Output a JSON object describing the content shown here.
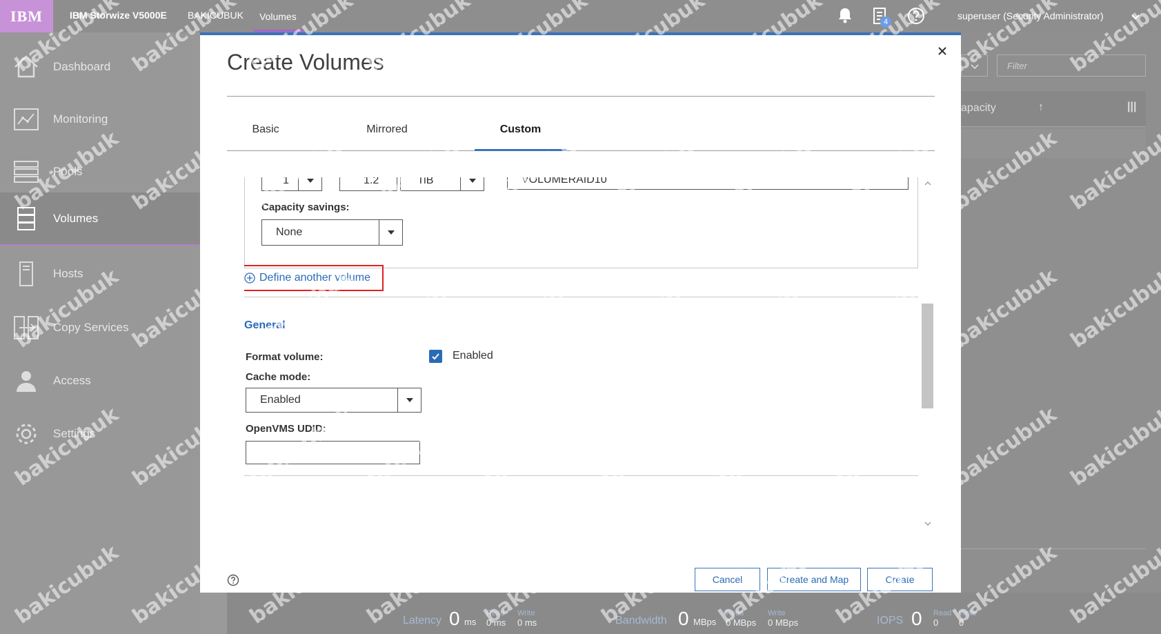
{
  "topbar": {
    "logo": "IBM",
    "product": "IBM Storwize V5000E",
    "system": "BAKICUBUK",
    "page": "Volumes",
    "tasks_count": "4",
    "user": "superuser (Security Administrator)"
  },
  "sidebar": {
    "items": [
      {
        "label": "Dashboard",
        "icon": "home-icon"
      },
      {
        "label": "Monitoring",
        "icon": "monitoring-icon"
      },
      {
        "label": "Pools",
        "icon": "pools-icon"
      },
      {
        "label": "Volumes",
        "icon": "volumes-icon",
        "active": true
      },
      {
        "label": "Hosts",
        "icon": "hosts-icon"
      },
      {
        "label": "Copy Services",
        "icon": "copy-services-icon"
      },
      {
        "label": "Access",
        "icon": "access-icon"
      },
      {
        "label": "Settings",
        "icon": "settings-icon"
      }
    ]
  },
  "background": {
    "filter_placeholder": "Filter",
    "capacity_col": "apacity"
  },
  "modal": {
    "title": "Create Volumes",
    "tabs": [
      "Basic",
      "Mirrored",
      "Custom"
    ],
    "active_tab": "Custom",
    "volume": {
      "quantity": "1",
      "capacity": "1.2",
      "unit": "TiB",
      "name": "VOLUMERAID10"
    },
    "capacity_savings_label": "Capacity savings:",
    "capacity_savings_value": "None",
    "define_link": "Define another volume",
    "general_header": "General",
    "format_volume_label": "Format volume:",
    "format_volume_checked": true,
    "format_volume_text": "Enabled",
    "cache_mode_label": "Cache mode:",
    "cache_mode_value": "Enabled",
    "openvms_label": "OpenVMS UDID:",
    "openvms_value": "",
    "buttons": {
      "cancel": "Cancel",
      "create_map": "Create and Map",
      "create": "Create"
    }
  },
  "status": {
    "latency_label": "Latency",
    "latency_value": "0",
    "latency_unit": "ms",
    "latency_read_label": "Read",
    "latency_read": "0 ms",
    "latency_write_label": "Write",
    "latency_write": "0 ms",
    "bandwidth_label": "Bandwidth",
    "bandwidth_value": "0",
    "bandwidth_unit": "MBps",
    "bandwidth_read_label": "Read",
    "bandwidth_read": "0 MBps",
    "bandwidth_write_label": "Write",
    "bandwidth_write": "0 MBps",
    "iops_label": "IOPS",
    "iops_value": "0",
    "iops_read_label": "Read",
    "iops_read": "0",
    "iops_write_label": "Write",
    "iops_write": "0"
  },
  "watermark": "bakicubuk",
  "colors": {
    "accent": "#3b73b9",
    "link": "#2a6bb5",
    "highlight_border": "#e02020",
    "logo_bg": "#c792d8"
  }
}
